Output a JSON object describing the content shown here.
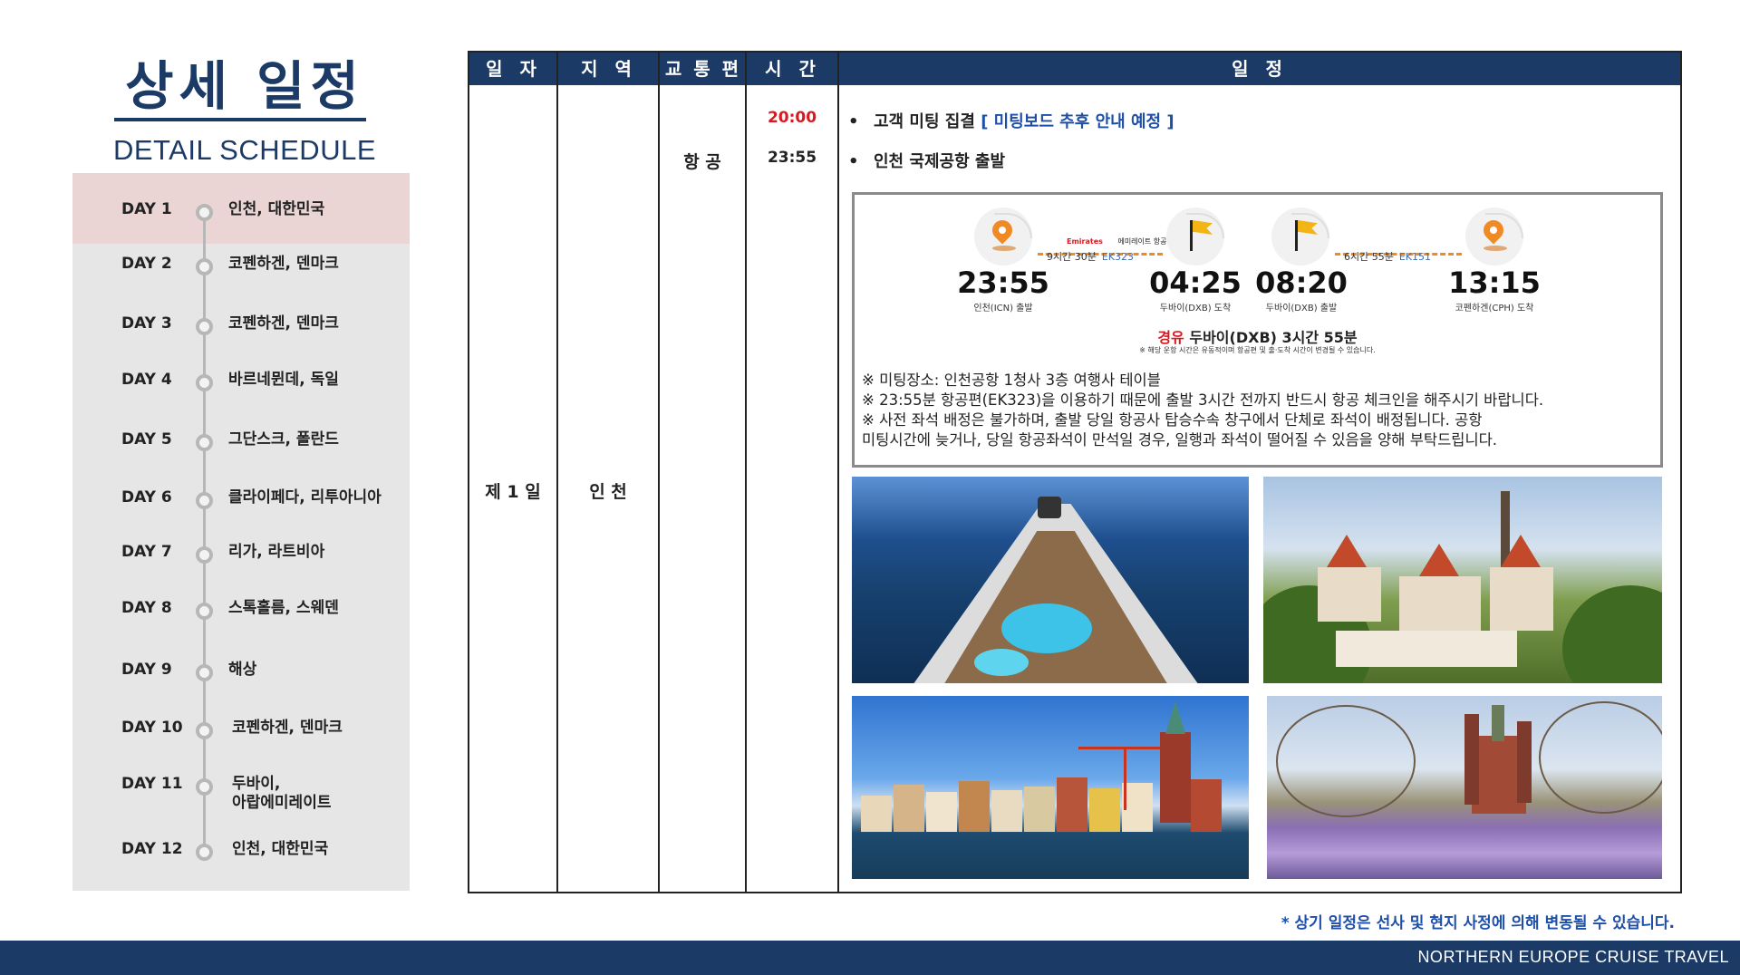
{
  "title": {
    "korean": "상세 일정",
    "english": "DETAIL SCHEDULE"
  },
  "days": [
    {
      "label": "DAY 1",
      "place": "인천, 대한민국",
      "active": true
    },
    {
      "label": "DAY 2",
      "place": "코펜하겐, 덴마크"
    },
    {
      "label": "DAY 3",
      "place": "코펜하겐, 덴마크"
    },
    {
      "label": "DAY 4",
      "place": "바르네뮌데, 독일"
    },
    {
      "label": "DAY 5",
      "place": "그단스크, 폴란드"
    },
    {
      "label": "DAY 6",
      "place": "클라이페다, 리투아니아"
    },
    {
      "label": "DAY 7",
      "place": "리가, 라트비아"
    },
    {
      "label": "DAY 8",
      "place": "스톡홀름, 스웨덴"
    },
    {
      "label": "DAY 9",
      "place": "해상"
    },
    {
      "label": "DAY 10",
      "place": "코펜하겐, 덴마크"
    },
    {
      "label": "DAY 11",
      "place": "두바이,",
      "place2": "아랍에미레이트"
    },
    {
      "label": "DAY 12",
      "place": "인천, 대한민국"
    }
  ],
  "table": {
    "headers": {
      "date": "일 자",
      "region": "지 역",
      "transport": "교 통 편",
      "time": "시 간",
      "itinerary": "일 정"
    },
    "row": {
      "date": "제 1 일",
      "region": "인 천",
      "transport": "항 공",
      "entries": [
        {
          "time": "20:00",
          "time_color": "#d71921",
          "text": "고객 미팅 집결",
          "note": "[ 미팅보드 추후 안내 예정 ]"
        },
        {
          "time": "23:55",
          "time_color": "#222222",
          "text": "인천 국제공항 출발",
          "note": ""
        }
      ]
    }
  },
  "flight": {
    "segments": [
      {
        "duration": "9시간 30분",
        "code": "EK323",
        "airline_logo": "Emirates",
        "airline_kr": "에미레이트 항공"
      },
      {
        "duration": "6시간 55분",
        "code": "EK151"
      }
    ],
    "points": [
      {
        "time": "23:55",
        "label": "인천(ICN) 출발",
        "icon": "map-pin-icon"
      },
      {
        "time": "04:25",
        "label": "두바이(DXB) 도착",
        "icon": "flag-icon"
      },
      {
        "time": "08:20",
        "label": "두바이(DXB) 출발",
        "icon": "flag-icon"
      },
      {
        "time": "13:15",
        "label": "코펜하겐(CPH) 도착",
        "icon": "map-pin-icon"
      }
    ],
    "layover_prefix": "경유",
    "layover_text": "두바이(DXB) 3시간 55분",
    "layover_note": "※ 해당 운항 시간은 유동적이며 항공편 및 출·도착 시간이 변경될 수 있습니다.",
    "notes": [
      "※ 미팅장소: 인천공항 1청사 3층 여행사 테이블",
      "※ 23:55분 항공편(EK323)을 이용하기 때문에 출발 3시간 전까지 반드시 항공 체크인을 해주시기 바랍니다.",
      "※ 사전 좌석 배정은 불가하며, 출발 당일 항공사 탑승수속 창구에서 단체로 좌석이 배정됩니다. 공항",
      "미팅시간에 늦거나, 당일 항공좌석이 만석일 경우, 일행과 좌석이 떨어질 수 있음을 양해 부탁드립니다."
    ]
  },
  "photos": [
    "cruise-ship-deck-photo",
    "tallinn-old-town-photo",
    "lubeck-harbor-photo",
    "castle-garden-photo"
  ],
  "disclaimer": "* 상기 일정은 선사 및 현지 사정에 의해 변동될 수 있습니다.",
  "footer": "NORTHERN EUROPE CRUISE TRAVEL",
  "colors": {
    "navy": "#1b3a66",
    "red": "#d71921",
    "blue_note": "#1e4fa8",
    "orange": "#f08a24"
  }
}
